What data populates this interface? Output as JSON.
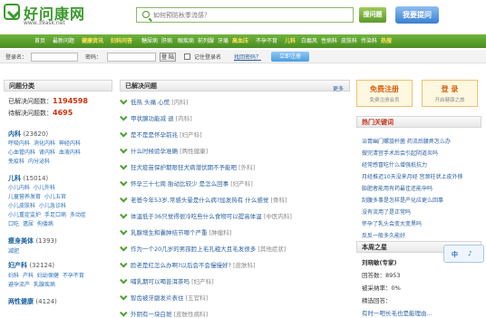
{
  "logo": {
    "title": "好问康网",
    "url": "www.39ask.net"
  },
  "search": {
    "placeholder": "如何预防秋季流感？",
    "search_label": "搜问题",
    "ask_label": "我要提问"
  },
  "nav": {
    "items": [
      "首页",
      "最新问题",
      "健康资讯",
      "妇科问答",
      "糖尿病",
      "肝病",
      "眼疾病",
      "前列腺",
      "牙痛",
      "高血压",
      "不孕不育",
      "儿科",
      "白癜风",
      "性病科",
      "皮肤科",
      "传染科",
      "热搜"
    ]
  },
  "loginbar": {
    "user_label": "登录名：",
    "pass_label": "密码：",
    "login_label": "登 陆",
    "remember_label": "记住登录名",
    "forgot_label": "找回密码？",
    "register_label": "立即注册"
  },
  "left": {
    "title": "问题分类",
    "solved_label": "已解决问题数：",
    "solved_value": "1194598",
    "pending_label": "待解决问题数：",
    "pending_value": "4695",
    "categories": [
      {
        "name": "内科",
        "count": "(23620)",
        "subs": [
          "呼吸内科",
          "消化内科",
          "神经内科",
          "心血管内科",
          "肾内科",
          "血液内科",
          "免疫科",
          "内分泌科"
        ]
      },
      {
        "name": "儿科",
        "count": "(15014)",
        "subs": [
          "小儿内科",
          "小儿外科",
          "儿童营养发育",
          "小儿五官",
          "小儿皮肤科",
          "小儿急诊科",
          "小儿重症监护",
          "手足口病",
          "多动症",
          "口吃",
          "遗尿",
          "佝偻病"
        ]
      },
      {
        "name": "瘦身美体",
        "count": "(1393)",
        "subs": [
          "减肥"
        ]
      },
      {
        "name": "妇产科",
        "count": "(32124)",
        "subs": [
          "妇科",
          "产科",
          "妇幼保健",
          "不孕不育",
          "避孕流产",
          "乳腺疾病"
        ]
      },
      {
        "name": "两性健康",
        "count": "(4124)",
        "subs": []
      }
    ]
  },
  "mid": {
    "title": "已解决问题",
    "more_label": "更多",
    "questions": [
      {
        "q": "低热 头痛 心慌",
        "tag": "[内科]"
      },
      {
        "q": "甲状腺功能减 退",
        "tag": "[内科]"
      },
      {
        "q": "是不是是怀孕前兆",
        "tag": "[妇产科]"
      },
      {
        "q": "什么时候验孕准确",
        "tag": "[两性健康]"
      },
      {
        "q": "狂犬疫苗保护期限狂犬病潜伏期不予能吧",
        "tag": "[外科]"
      },
      {
        "q": "怀孕三十七周 胎动比较少 是怎么回事",
        "tag": "[妇产科]"
      },
      {
        "q": "老爸今年53岁,常感头晕是什么病?加发热有 什么感觉",
        "tag": "[骨科]"
      },
      {
        "q": "体温低于36只觉得很冷吃些什么食物可以提高体温",
        "tag": "[中医内科]"
      },
      {
        "q": "乳腺增生和囊肿结节哪个严重",
        "tag": "[肿瘤科]"
      },
      {
        "q": "作为一个20几岁的男孩脸上毛孔粗大且毛发很多",
        "tag": "[其他症状]"
      },
      {
        "q": "脸老是红怎么办啊?以后会不会慢慢好?",
        "tag": "[皮肤科]"
      },
      {
        "q": "哺乳期可以喝普洱茶吗",
        "tag": "[妇产科]"
      },
      {
        "q": "智齿被牙龈发炎表住",
        "tag": "[五官科]"
      },
      {
        "q": "外阴有一块白斑",
        "tag": "[皮肤性病科]"
      }
    ]
  },
  "right": {
    "register": {
      "title": "免费注册",
      "sub": "免费注册会员"
    },
    "login": {
      "title": "登 录",
      "sub": "开启健康之旅"
    },
    "hot_title": "热门关键词",
    "hot": [
      "治胃幽门螺旋杆菌 药流后腰疼怎么办",
      "做完清宫手术后会引起阴道炎吗",
      "经常感冒吃什么增强抵抗力",
      "月经推迟10天没来月经 宫颈柱状上皮外移",
      "胎肥者能用有药最佳还能孕吗",
      "刮腹多事是怎样是产化应更么回事",
      "没有流用了是正常吗",
      "怀孕了乳头会变大变黑吗",
      "反反一般多久能好"
    ],
    "star_title": "本周之星",
    "star": {
      "name": "刘晓敏(专家)",
      "answers_label": "回答数：",
      "answers": "8953",
      "adopt_label": "被采纳率：",
      "adopt": "0%",
      "best_label": "精选回答：",
      "best_q": "有时一吧长毛也是能理由..."
    }
  },
  "widget": {
    "label1": "中",
    "label2": "♪"
  }
}
